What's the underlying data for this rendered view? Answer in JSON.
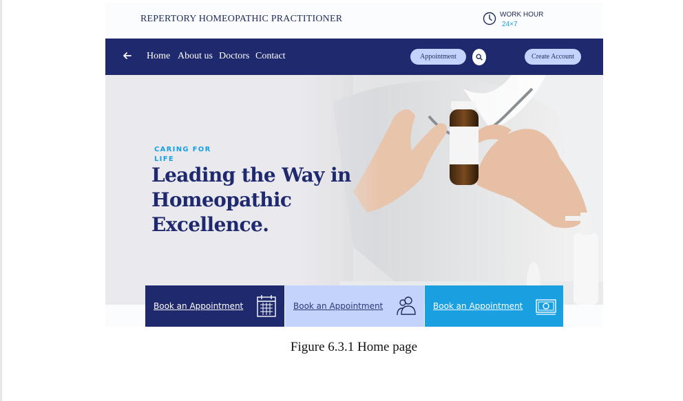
{
  "header": {
    "brand": "REPERTORY HOMEOPATHIC PRACTITIONER",
    "work_hour_title": "WORK HOUR",
    "work_hour_value": "24×7",
    "clock_icon": "clock-icon"
  },
  "nav": {
    "back_icon": "arrow-left-icon",
    "links": [
      "Home",
      "About us",
      "Doctors",
      "Contact"
    ],
    "appointment_label": "Appointment",
    "search_icon": "search-icon",
    "create_account_label": "Create Account"
  },
  "hero": {
    "tagline": "CARING FOR LIFE",
    "headline": "Leading the Way in Homeopathic Excellence."
  },
  "cards": [
    {
      "label": "Book an Appointment",
      "icon": "calendar-icon",
      "background": "#1f2a6e",
      "text_color": "#ffffff"
    },
    {
      "label": "Book an Appointment",
      "icon": "users-icon",
      "background": "#c3d3fb",
      "text_color": "#2a3a7a"
    },
    {
      "label": "Book an Appointment",
      "icon": "money-icon",
      "background": "#1aa0e0",
      "text_color": "#ffffff"
    }
  ],
  "caption": "Figure 6.3.1 Home page",
  "colors": {
    "navy": "#1f2a6e",
    "accent_blue": "#1aa0e0",
    "pill": "#c3d3fb"
  }
}
